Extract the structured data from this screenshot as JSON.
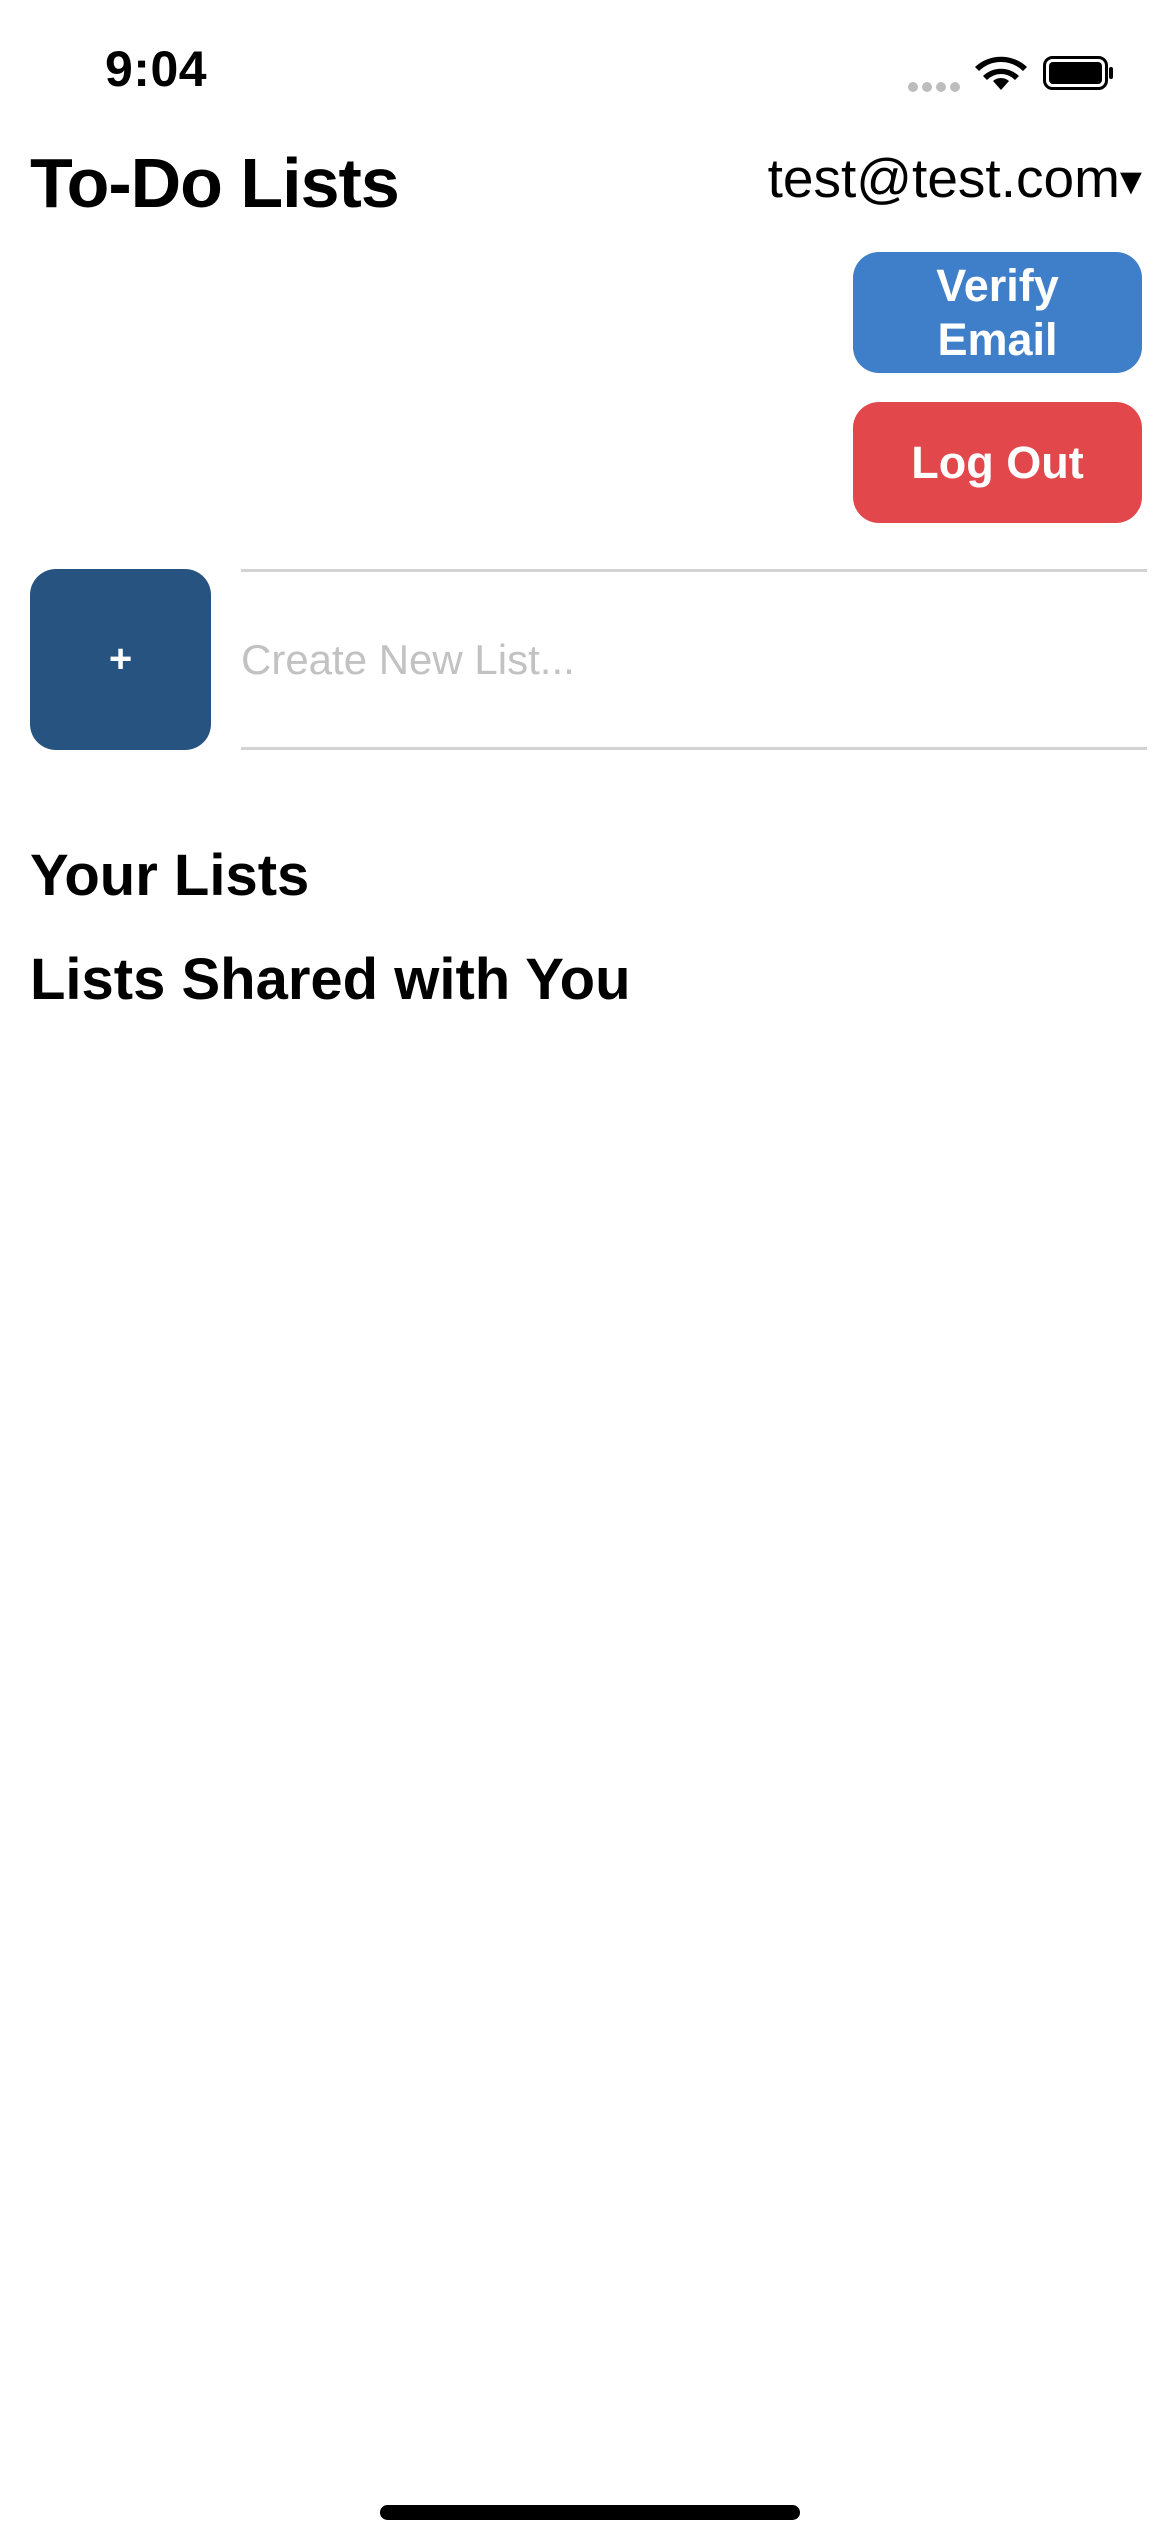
{
  "status_bar": {
    "time": "9:04",
    "signal_icon": "signal-dots-icon",
    "wifi_icon": "wifi-icon",
    "battery_icon": "battery-icon"
  },
  "header": {
    "title": "To-Do Lists",
    "account_email": "test@test.com",
    "account_caret": "▾"
  },
  "actions": {
    "verify_email_label": "Verify Email",
    "log_out_label": "Log Out"
  },
  "new_list": {
    "add_label": "+",
    "placeholder": "Create New List...",
    "value": ""
  },
  "sections": {
    "your_lists": "Your Lists",
    "shared_lists": "Lists Shared with You"
  },
  "colors": {
    "verify_button": "#3f7ec8",
    "log_out_button": "#e2474b",
    "add_button": "#26537f",
    "placeholder_text": "#c2c2c2"
  }
}
